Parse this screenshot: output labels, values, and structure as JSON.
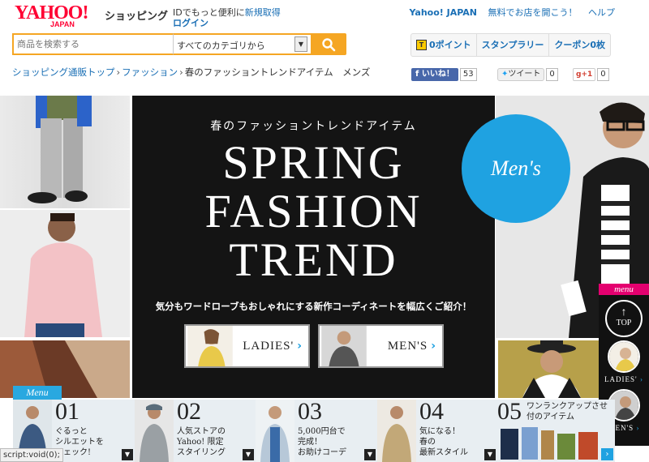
{
  "header": {
    "logo_main": "YAHOO!",
    "logo_sub": "JAPAN",
    "service_name": "ショッピング",
    "id_text": "IDでもっと便利に",
    "signup_link": "新規取得",
    "login_link": "ログイン",
    "top_links": [
      "Yahoo! JAPAN",
      "無料でお店を開こう！",
      "ヘルプ"
    ]
  },
  "search": {
    "placeholder": "商品を検索する",
    "category": "すべてのカテゴリから"
  },
  "user_tabs": {
    "points": "0ポイント",
    "stamp_rally": "スタンプラリー",
    "coupons": "クーポン0枚"
  },
  "breadcrumb": {
    "items": [
      "ショッピング通販トップ",
      "ファッション"
    ],
    "current": "春のファッショントレンドアイテム　メンズ",
    "separator": "›"
  },
  "social": {
    "like_label": "いいね！",
    "like_count": "53",
    "tweet_label": "ツイート",
    "tweet_count": "0",
    "gplus_label": "g+1",
    "gplus_count": "0"
  },
  "hero": {
    "subtitle": "春のファッショントレンドアイテム",
    "title_lines": [
      "SPRING",
      "FASHION",
      "TREND"
    ],
    "description": "気分もワードローブもおしゃれにする新作コーディネートを幅広くご紹介！",
    "ladies_button": "LADIES'",
    "mens_button": "MEN'S",
    "mens_badge": "Men's"
  },
  "side_menu": {
    "header": "menu",
    "top_label": "TOP",
    "ladies_label": "LADIES'",
    "mens_label": "MEN'S"
  },
  "menu_strip": {
    "tab_label": "Menu",
    "items": [
      {
        "num": "01",
        "text": "ぐるっと\nシルエットを\nチェック!"
      },
      {
        "num": "02",
        "text": "人気ストアの\nYahoo! 限定\nスタイリング"
      },
      {
        "num": "03",
        "text": "5,000円台で\n完成！\nお助けコーデ"
      },
      {
        "num": "04",
        "text": "気になる！\n春の\n最新スタイル"
      },
      {
        "num": "05",
        "text": "ワンランクアップさせ\n付のアイテム"
      }
    ]
  },
  "status_bar": "script:void(0);",
  "colors": {
    "accent_orange": "#f5a623",
    "yahoo_red": "#ff0033",
    "link_blue": "#1a6fb5",
    "badge_blue": "#1fa2e1",
    "menu_pink": "#e4006f"
  }
}
